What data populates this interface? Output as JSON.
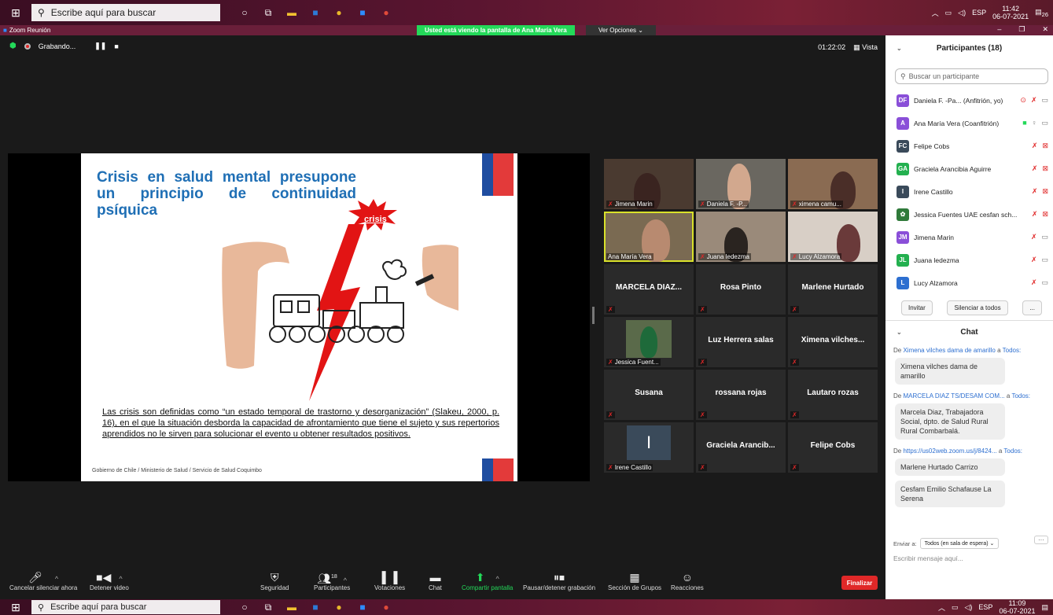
{
  "taskbar": {
    "search_placeholder": "Escribe aquí para buscar",
    "lang": "ESP",
    "time_top": "11:42",
    "date_top": "06-07-2021",
    "time_bottom": "11:09",
    "date_bottom": "06-07-2021",
    "notif_count": "26"
  },
  "window": {
    "title": "Zoom Reunión",
    "share_banner": "Usted está viendo la pantalla de Ana María Vera",
    "view_options": "Ver Opciones ⌄"
  },
  "meeting": {
    "recording_label": "Grabando...",
    "timer": "01:22:02",
    "view_label": "Vista"
  },
  "slide": {
    "title": "Crisis en salud mental presupone un principio de continuidad psíquica",
    "crisis_label": "crisis",
    "body": "Las crisis son definidas como “un estado temporal de trastorno y desorganización” (Slakeu, 2000, p. 16), en el que la situación desborda la capacidad de afrontamiento que tiene el sujeto y sus repertorios aprendidos no le sirven para solucionar el evento u obtener resultados positivos.",
    "footer": "Gobierno de Chile / Ministerio de Salud / Servicio de Salud Coquimbo"
  },
  "gallery": {
    "tiles": [
      {
        "name": "Jimena Marin"
      },
      {
        "name": "Daniela F. -P..."
      },
      {
        "name": "ximena camu..."
      },
      {
        "name": "Ana María Vera"
      },
      {
        "name": "Juana ledezma"
      },
      {
        "name": "Lucy Alzamora"
      },
      {
        "name": "MARCELA DIAZ..."
      },
      {
        "name": "Rosa Pinto"
      },
      {
        "name": "Marlene Hurtado"
      },
      {
        "name": "Jessica Fuent..."
      },
      {
        "name": "Luz Herrera salas"
      },
      {
        "name": "Ximena vilches..."
      },
      {
        "name": "Susana"
      },
      {
        "name": "rossana rojas"
      },
      {
        "name": "Lautaro rozas"
      },
      {
        "name": "Irene Castillo",
        "initial": "I"
      },
      {
        "name": "Graciela Arancib..."
      },
      {
        "name": "Felipe Cobs"
      }
    ]
  },
  "toolbar": {
    "mute": "Cancelar silenciar ahora",
    "video": "Detener video",
    "security": "Seguridad",
    "participants": "Participantes",
    "participants_count": "18",
    "polls": "Votaciones",
    "chat": "Chat",
    "share": "Compartir pantalla",
    "pause_rec": "Pausar/detener grabación",
    "breakout": "Sección de Grupos",
    "reactions": "Reacciones",
    "end": "Finalizar"
  },
  "participants_panel": {
    "title": "Participantes (18)",
    "search_placeholder": "Buscar un participante",
    "rows": [
      {
        "initials": "DF",
        "name": "Daniela F. -Pa... (Anfitrión, yo)",
        "color": "#8a4fd8"
      },
      {
        "initials": "A",
        "name": "Ana María Vera (Coanfitrión)",
        "color": "#8a4fd8"
      },
      {
        "initials": "FC",
        "name": "Felipe Cobs",
        "color": "#3a4a5a"
      },
      {
        "initials": "GA",
        "name": "Graciela Arancibia Aguirre",
        "color": "#23b04f"
      },
      {
        "initials": "I",
        "name": "Irene Castillo",
        "color": "#3a4a5a"
      },
      {
        "initials": "",
        "name": "Jessica Fuentes UAE cesfan sch...",
        "color": "#2f7a3a"
      },
      {
        "initials": "JM",
        "name": "Jimena Marin",
        "color": "#8a4fd8"
      },
      {
        "initials": "JL",
        "name": "Juana ledezma",
        "color": "#23b04f"
      },
      {
        "initials": "L",
        "name": "Lucy Alzamora",
        "color": "#2d6fd0"
      }
    ],
    "invite": "Invitar",
    "mute_all": "Silenciar a todos",
    "more": "..."
  },
  "chat_panel": {
    "title": "Chat",
    "messages": [
      {
        "from_prefix": "De",
        "from": "Ximena vilches dama de amarillo",
        "to_prefix": "a",
        "to": "Todos:",
        "texts": [
          "Ximena vilches dama de amarillo"
        ]
      },
      {
        "from_prefix": "De",
        "from": "MARCELA DIAZ TS/DESAM COM...",
        "to_prefix": "a",
        "to": "Todos:",
        "texts": [
          "Marcela Diaz, Trabajadora Social, dpto. de Salud Rural Rural Combarbalá."
        ]
      },
      {
        "from_prefix": "De",
        "from": "https://us02web.zoom.us/j/8424...",
        "to_prefix": "a",
        "to": "Todos:",
        "texts": [
          "Marlene Hurtado Carrizo",
          "Cesfam Emilio Schafause La Serena"
        ]
      }
    ],
    "send_to_label": "Enviar a:",
    "send_to_value": "Todos (en sala de espera) ⌄",
    "input_placeholder": "Escribir mensaje aquí..."
  }
}
